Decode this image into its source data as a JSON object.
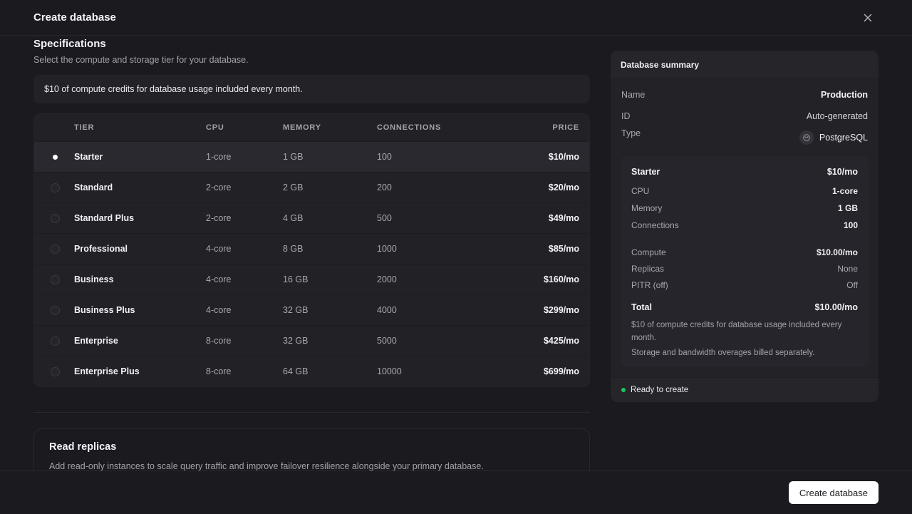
{
  "header": {
    "title": "Create database"
  },
  "specs": {
    "title": "Specifications",
    "description": "Select the compute and storage tier for your database.",
    "credit_banner": "$10 of compute credits for database usage included every month.",
    "columns": {
      "tier": "TIER",
      "cpu": "CPU",
      "memory": "MEMORY",
      "connections": "CONNECTIONS",
      "price": "PRICE"
    },
    "tiers": [
      {
        "name": "Starter",
        "cpu": "1-core",
        "memory": "1 GB",
        "connections": "100",
        "price": "$10/mo",
        "selected": true
      },
      {
        "name": "Standard",
        "cpu": "2-core",
        "memory": "2 GB",
        "connections": "200",
        "price": "$20/mo",
        "selected": false
      },
      {
        "name": "Standard Plus",
        "cpu": "2-core",
        "memory": "4 GB",
        "connections": "500",
        "price": "$49/mo",
        "selected": false
      },
      {
        "name": "Professional",
        "cpu": "4-core",
        "memory": "8 GB",
        "connections": "1000",
        "price": "$85/mo",
        "selected": false
      },
      {
        "name": "Business",
        "cpu": "4-core",
        "memory": "16 GB",
        "connections": "2000",
        "price": "$160/mo",
        "selected": false
      },
      {
        "name": "Business Plus",
        "cpu": "4-core",
        "memory": "32 GB",
        "connections": "4000",
        "price": "$299/mo",
        "selected": false
      },
      {
        "name": "Enterprise",
        "cpu": "8-core",
        "memory": "32 GB",
        "connections": "5000",
        "price": "$425/mo",
        "selected": false
      },
      {
        "name": "Enterprise Plus",
        "cpu": "8-core",
        "memory": "64 GB",
        "connections": "10000",
        "price": "$699/mo",
        "selected": false
      }
    ]
  },
  "replicas": {
    "title": "Read replicas",
    "description": "Add read-only instances to scale query traffic and improve failover resilience alongside your primary database."
  },
  "summary": {
    "title": "Database summary",
    "name_label": "Name",
    "name_value": "Production",
    "id_label": "ID",
    "id_value": "Auto-generated",
    "type_label": "Type",
    "type_value": "PostgreSQL",
    "type_icon": "postgresql-icon",
    "plan": {
      "tier": "Starter",
      "tier_price": "$10/mo",
      "cpu_label": "CPU",
      "cpu_value": "1-core",
      "memory_label": "Memory",
      "memory_value": "1 GB",
      "connections_label": "Connections",
      "connections_value": "100",
      "compute_label": "Compute",
      "compute_value": "$10.00/mo",
      "replicas_label": "Replicas",
      "replicas_value": "None",
      "pitr_label": "PITR (off)",
      "pitr_value": "Off",
      "total_label": "Total",
      "total_value": "$10.00/mo",
      "note_credits": "$10 of compute credits for database usage included every month.",
      "note_overage": "Storage and bandwidth overages billed separately."
    },
    "status": "Ready to create",
    "status_color": "#22c55e"
  },
  "footer": {
    "create_label": "Create database"
  }
}
